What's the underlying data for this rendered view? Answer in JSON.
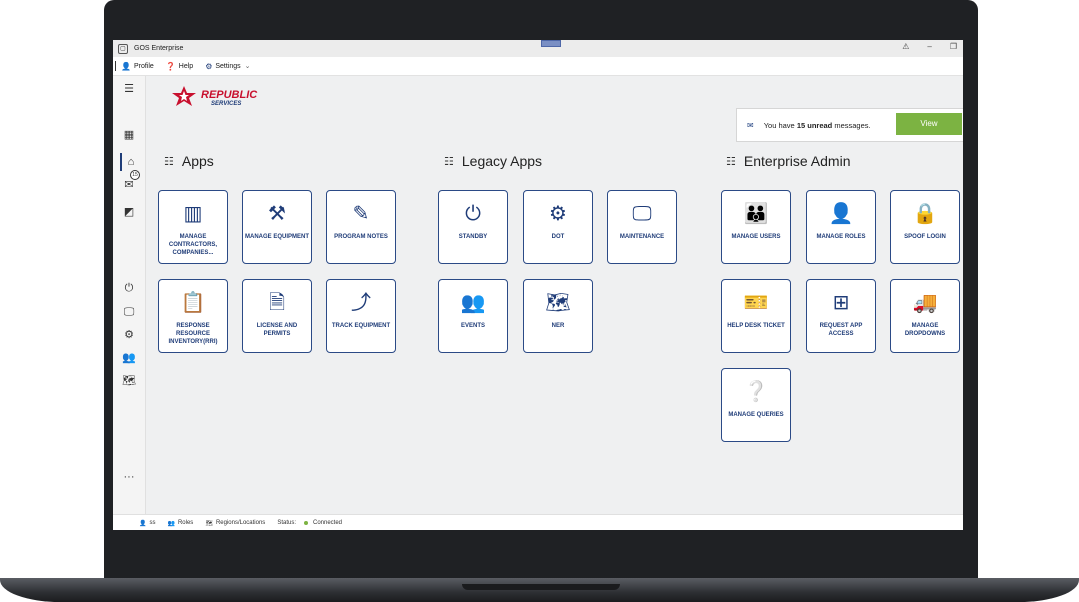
{
  "window": {
    "title": "GOS Enterprise"
  },
  "menu": {
    "profile": "Profile",
    "help": "Help",
    "settings": "Settings"
  },
  "messages": {
    "prefix": "You have",
    "count": "15 unread",
    "suffix": "messages.",
    "view_label": "View",
    "badge": "15"
  },
  "brand": {
    "name": "REPUBLIC",
    "sub": "SERVICES",
    "color": "#c8102e"
  },
  "sections": {
    "apps": "Apps",
    "legacy": "Legacy Apps",
    "admin": "Enterprise Admin"
  },
  "apps": [
    {
      "label": "MANAGE CONTRACTORS, COMPANIES...",
      "icon": "building-icon"
    },
    {
      "label": "MANAGE EQUIPMENT",
      "icon": "tools-icon"
    },
    {
      "label": "PROGRAM NOTES",
      "icon": "note-edit-icon"
    },
    {
      "label": "RESPONSE RESOURCE INVENTORY(RRI)",
      "icon": "clipboard-check-icon"
    },
    {
      "label": "LICENSE AND PERMITS",
      "icon": "document-icon"
    },
    {
      "label": "TRACK EQUIPMENT",
      "icon": "route-icon"
    }
  ],
  "legacy_apps": [
    {
      "label": "STANDBY",
      "icon": "power-icon"
    },
    {
      "label": "DOT",
      "icon": "gear-icon"
    },
    {
      "label": "MAINTENANCE",
      "icon": "monitor-icon"
    },
    {
      "label": "EVENTS",
      "icon": "people-list-icon"
    },
    {
      "label": "NER",
      "icon": "map-icon"
    }
  ],
  "admin_apps": [
    {
      "label": "MANAGE USERS",
      "icon": "users-group-icon"
    },
    {
      "label": "MANAGE ROLES",
      "icon": "user-gear-icon"
    },
    {
      "label": "SPOOF LOGIN",
      "icon": "user-lock-icon"
    },
    {
      "label": "HELP DESK TICKET",
      "icon": "ticket-add-icon"
    },
    {
      "label": "REQUEST APP ACCESS",
      "icon": "grid-add-icon"
    },
    {
      "label": "MANAGE DROPDOWNS",
      "icon": "truck-box-icon"
    },
    {
      "label": "MANAGE QUERIES",
      "icon": "user-question-icon"
    }
  ],
  "status": {
    "user": "ss",
    "roles": "Roles",
    "regions": "Regions/Locations",
    "status_label": "Status:",
    "status_value": "Connected"
  },
  "colors": {
    "accent": "#1f3c78",
    "success": "#7cb342"
  }
}
